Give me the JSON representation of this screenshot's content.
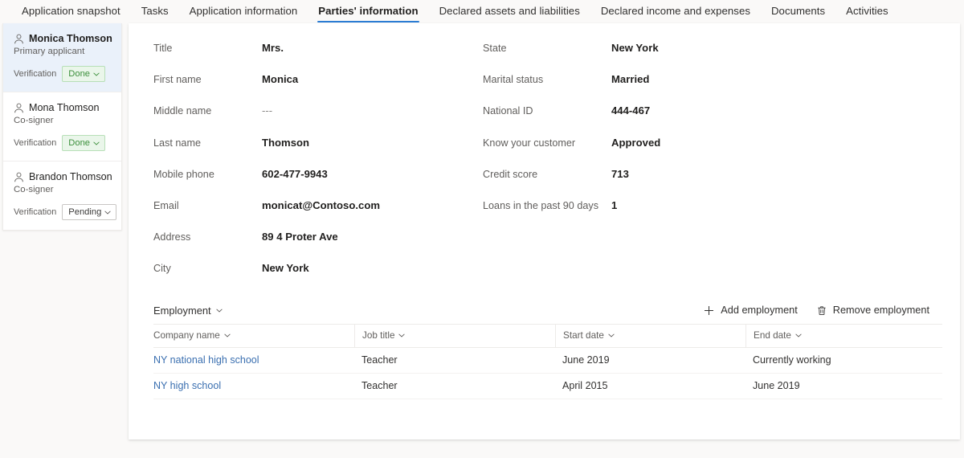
{
  "tabs": [
    {
      "label": "Application snapshot",
      "active": false
    },
    {
      "label": "Tasks",
      "active": false
    },
    {
      "label": "Application information",
      "active": false
    },
    {
      "label": "Parties' information",
      "active": true
    },
    {
      "label": "Declared assets and liabilities",
      "active": false
    },
    {
      "label": "Declared income and expenses",
      "active": false
    },
    {
      "label": "Documents",
      "active": false
    },
    {
      "label": "Activities",
      "active": false
    }
  ],
  "parties": [
    {
      "name": "Monica Thomson",
      "role": "Primary applicant",
      "verification_label": "Verification",
      "status": "Done",
      "status_kind": "done",
      "selected": true
    },
    {
      "name": "Mona Thomson",
      "role": "Co-signer",
      "verification_label": "Verification",
      "status": "Done",
      "status_kind": "done",
      "selected": false
    },
    {
      "name": "Brandon Thomson",
      "role": "Co-signer",
      "verification_label": "Verification",
      "status": "Pending",
      "status_kind": "pending",
      "selected": false
    }
  ],
  "details": {
    "left": [
      {
        "label": "Title",
        "value": "Mrs.",
        "muted": false
      },
      {
        "label": "First name",
        "value": "Monica",
        "muted": false
      },
      {
        "label": "Middle name",
        "value": "---",
        "muted": true
      },
      {
        "label": "Last name",
        "value": "Thomson",
        "muted": false
      },
      {
        "label": "Mobile phone",
        "value": "602-477-9943",
        "muted": false
      },
      {
        "label": "Email",
        "value": "monicat@Contoso.com",
        "muted": false
      },
      {
        "label": "Address",
        "value": "89 4 Proter Ave",
        "muted": false
      },
      {
        "label": "City",
        "value": "New York",
        "muted": false
      }
    ],
    "right": [
      {
        "label": "State",
        "value": "New York",
        "muted": false
      },
      {
        "label": "Marital status",
        "value": "Married",
        "muted": false
      },
      {
        "label": "National ID",
        "value": "444-467",
        "muted": false
      },
      {
        "label": "Know your customer",
        "value": "Approved",
        "muted": false
      },
      {
        "label": "Credit score",
        "value": "713",
        "muted": false
      },
      {
        "label": "Loans in the past 90 days",
        "value": "1",
        "muted": false
      }
    ]
  },
  "employment": {
    "title": "Employment",
    "add_label": "Add  employment",
    "remove_label": "Remove employment",
    "columns": [
      "Company name",
      "Job title",
      "Start date",
      "End date"
    ],
    "rows": [
      {
        "company": "NY national high school",
        "job_title": "Teacher",
        "start_date": "June  2019",
        "end_date": "Currently working"
      },
      {
        "company": "NY high school",
        "job_title": "Teacher",
        "start_date": "April  2015",
        "end_date": "June 2019"
      }
    ]
  },
  "colors": {
    "accent": "#2b7cd3",
    "link": "#3a6fb0",
    "status_done": "#3c8f3c",
    "status_pending": "#3b3a39",
    "page_bg": "#faf9f8",
    "panel_bg": "#ffffff",
    "selected_bg": "#eaf1fa"
  }
}
